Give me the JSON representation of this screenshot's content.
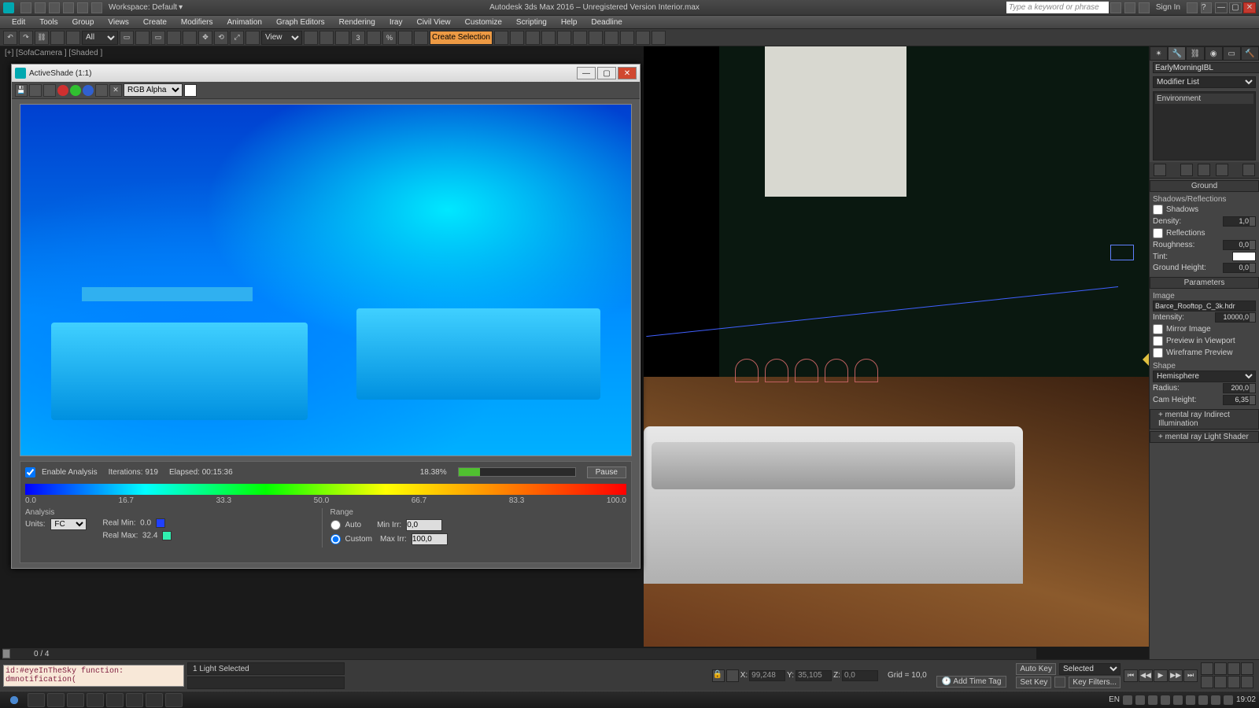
{
  "window": {
    "title": "Autodesk 3ds Max 2016 – Unregistered Version   Interior.max",
    "workspace_label": "Workspace: Default",
    "search_placeholder": "Type a keyword or phrase",
    "signin": "Sign In"
  },
  "menu": [
    "Edit",
    "Tools",
    "Group",
    "Views",
    "Create",
    "Modifiers",
    "Animation",
    "Graph Editors",
    "Rendering",
    "Iray",
    "Civil View",
    "Customize",
    "Scripting",
    "Help",
    "Deadline"
  ],
  "toolbar": {
    "filter_all": "All",
    "view_dd": "View",
    "selection_set": "Create Selection Se"
  },
  "viewport": {
    "label": "[+] [SofaCamera ] [Shaded ]",
    "timeline_frame": "0 / 4"
  },
  "activeshade": {
    "title": "ActiveShade (1:1)",
    "channel": "RGB Alpha",
    "analysis": {
      "enable": "Enable Analysis",
      "iterations_label": "Iterations:",
      "iterations": "919",
      "elapsed_label": "Elapsed:",
      "elapsed": "00:15:36",
      "progress_pct": "18.38%",
      "progress_val": 18.38,
      "pause": "Pause",
      "ticks": [
        "0.0",
        "16.7",
        "33.3",
        "50.0",
        "66.7",
        "83.3",
        "100.0"
      ],
      "analysis_label": "Analysis",
      "units_label": "Units:",
      "units": "FC",
      "real_min_label": "Real Min:",
      "real_min": "0.0",
      "real_max_label": "Real Max:",
      "real_max": "32.4",
      "range_label": "Range",
      "auto": "Auto",
      "custom": "Custom",
      "min_irr_label": "Min Irr:",
      "min_irr": "0,0",
      "max_irr_label": "Max Irr:",
      "max_irr": "100,0"
    }
  },
  "cmd": {
    "obj_name": "EarlyMorningIBL",
    "modlist": "Modifier List",
    "stack_item": "Environment",
    "ground": {
      "header": "Ground",
      "shad_refl": "Shadows/Reflections",
      "shadows": "Shadows",
      "density": "Density:",
      "density_v": "1,0",
      "reflections": "Reflections",
      "roughness": "Roughness:",
      "roughness_v": "0,0",
      "tint": "Tint:",
      "gheight": "Ground Height:",
      "gheight_v": "0,0"
    },
    "params": {
      "header": "Parameters",
      "image": "Image",
      "image_file": "Barce_Rooftop_C_3k.hdr",
      "intensity": "Intensity:",
      "intensity_v": "10000,0",
      "mirror": "Mirror Image",
      "preview": "Preview in Viewport",
      "wire": "Wireframe Preview",
      "shape": "Shape",
      "shape_v": "Hemisphere",
      "radius": "Radius:",
      "radius_v": "200,0",
      "camh": "Cam Height:",
      "camh_v": "6,35"
    },
    "roll1": "mental ray Indirect Illumination",
    "roll2": "mental ray Light Shader"
  },
  "status": {
    "maxscript": "id:#eyeInTheSky   function: dmnotification(",
    "selection": "1 Light Selected",
    "x": "99,248",
    "y": "35,105",
    "z": "0,0",
    "grid": "Grid = 10,0",
    "add_time_tag": "Add Time Tag",
    "auto_key": "Auto Key",
    "set_key": "Set Key",
    "selected": "Selected",
    "key_filters": "Key Filters..."
  },
  "taskbar": {
    "lang": "EN",
    "clock": "19:02"
  }
}
